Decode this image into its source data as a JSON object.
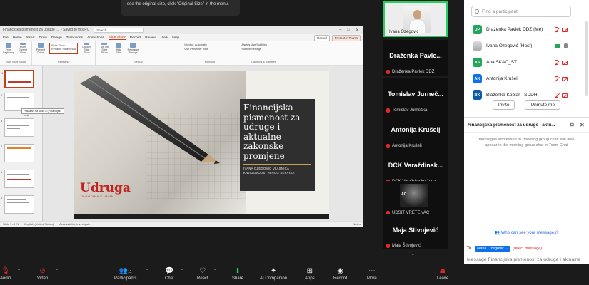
{
  "tooltip": {
    "text": "see the original size, click \"Original Size\" in the menu."
  },
  "powerpoint": {
    "file_name": "Financijska pismenost za udruge i... • Saved to this PC",
    "search_placeholder": "Search",
    "tabs": [
      "File",
      "Home",
      "Insert",
      "Draw",
      "Design",
      "Transitions",
      "Animations",
      "Slide Show",
      "Record",
      "Review",
      "View",
      "Help"
    ],
    "active_tab": "Slide Show",
    "record_btn": "Record",
    "present_btn": "Present in Teams",
    "ribbon_groups": [
      {
        "label": "Start Slide Show",
        "items": [
          "From Beginning",
          "From Current Slide"
        ]
      },
      {
        "label": "Rehearse",
        "items": [
          "Present Online",
          "Custom Slide Show"
        ]
      },
      {
        "label": "Set Up",
        "items": [
          "Set Up Slide Show",
          "Hide Slide",
          "Rehearse Timings"
        ]
      },
      {
        "label": "Monitors",
        "items": [
          "Monitor: Automatic",
          "Use Presenter View"
        ]
      },
      {
        "label": "Captions & Subtitles",
        "items": [
          "Always Use Subtitles",
          "Subtitle Settings"
        ]
      }
    ],
    "dropdown": [
      "Slide Show",
      "Rename Slide Show"
    ],
    "thumb_tip": "Prikazan na sudu o (Financijski web)",
    "status_left": "Slide 1 of 21",
    "status_mid": "English (United States)",
    "status_acc": "Accessibility: Investigate",
    "status_right": "Notes"
  },
  "slide": {
    "title": "Financijska pismenost za udruge i aktualne zakonske promjene",
    "subtitle": "IVANA OŽEGOVIĆ VLASNICA KNJIGOVODSTVENOG SERVISA",
    "logo_text": "Udruga",
    "logo_sub": "15 GODINA S VAMA"
  },
  "gallery": {
    "tiles": [
      {
        "name": "",
        "label": "Ivana Ozegović",
        "active": true
      },
      {
        "name": "Draženka Pavle...",
        "label": "Draženka Pavlek DDZ"
      },
      {
        "name": "Tomislav Jurneč...",
        "label": "Tomislav Jurnečka"
      },
      {
        "name": "Antonija Krušelj",
        "label": "Antonija Krušelj"
      },
      {
        "name": "DCK Varaždinsk...",
        "label": "DCK Varaždinske župa..."
      },
      {
        "name": "",
        "label": "UDSIT VRETENAC",
        "image_text": "AC"
      },
      {
        "name": "Maja Štivojević",
        "label": "Maja Štivojević"
      }
    ]
  },
  "participants": {
    "search_placeholder": "Find a participant",
    "list": [
      {
        "initials": "DP",
        "color": "#23a55a",
        "name": "Draženka Pavlek DDZ (Me)",
        "cam": "off",
        "mic": "off"
      },
      {
        "initials": "",
        "color": "",
        "name": "Ivana Ozegović (Host)",
        "cam": "on",
        "mic": "on"
      },
      {
        "initials": "AS",
        "color": "#23a55a",
        "name": "Ana SKAC_ST",
        "cam": "off",
        "mic": "off"
      },
      {
        "initials": "AK",
        "color": "#0e71eb",
        "name": "Antonija Krušelj",
        "cam": "off",
        "mic": "off"
      },
      {
        "initials": "BK",
        "color": "#0e5aa8",
        "name": "Blazenka Koblar - SDDH",
        "cam": "off",
        "mic": "off"
      }
    ],
    "invite": "Invite",
    "unmute_me": "Unmute me"
  },
  "chat": {
    "title": "Financijska pismenost za udruge i aktu...",
    "info": "Messages addressed to \"meeting group chat\" will also appear in the meeting group chat in Team Chat",
    "who_can_see": "Who can see your messages?",
    "to_label": "To:",
    "recipient": "Ivana Ozegović",
    "direct": "(direct message)",
    "placeholder": "Message Financijska pismenost za udruge i aktualne zakonske promjene"
  },
  "toolbar": {
    "audio": "Audio",
    "video": "Video",
    "participants": "Participants",
    "participants_count": "11",
    "chat": "Chat",
    "react": "React",
    "share": "Share",
    "ai": "AI Companion",
    "apps": "Apps",
    "record": "Record",
    "more": "More",
    "leave": "Leave"
  },
  "colors": {
    "accent": "#c43e1c",
    "zoom_green": "#23d160",
    "mute_red": "#e02828",
    "zoom_blue": "#0e71eb"
  }
}
